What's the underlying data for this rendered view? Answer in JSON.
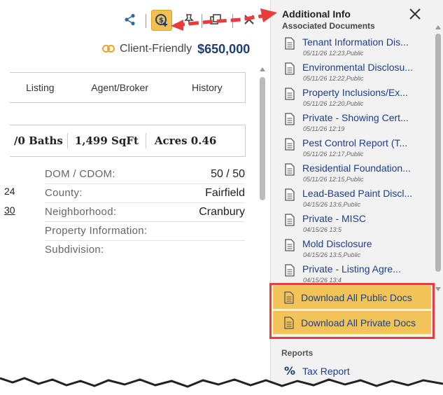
{
  "toolbar": {
    "icons": [
      "share-icon",
      "download-info-icon",
      "pin-icon",
      "copy-icon",
      "close-icon"
    ],
    "highlight_color": "#f3c04f"
  },
  "listing": {
    "client_friendly_label": "Client-Friendly",
    "price": "$650,000",
    "tabs": [
      "Listing",
      "Agent/Broker",
      "History"
    ],
    "stats": [
      "/0 Baths",
      "1,499 SqFt",
      "Acres 0.46"
    ],
    "details": [
      {
        "label": "DOM / CDOM:",
        "value": "50 / 50"
      },
      {
        "label": "County:",
        "value": "Fairfield"
      },
      {
        "label": "Neighborhood:",
        "value": "Cranbury"
      },
      {
        "label": "Property Information:",
        "value": ""
      },
      {
        "label": "Subdivision:",
        "value": ""
      }
    ],
    "fragments": [
      "24",
      "30"
    ]
  },
  "panel": {
    "title": "Additional Info",
    "section": "Associated Documents",
    "documents": [
      {
        "name": "Tenant Information Dis...",
        "meta": "05/11/26 12:23,Public"
      },
      {
        "name": "Environmental Disclosu...",
        "meta": "05/11/26 12:22,Public"
      },
      {
        "name": "Property Inclusions/Ex...",
        "meta": "05/11/26 12:20,Public"
      },
      {
        "name": "Private - Showing Cert...",
        "meta": "05/11/26 12:19"
      },
      {
        "name": "Pest Control Report (T...",
        "meta": "05/11/26 12:17,Public"
      },
      {
        "name": "Residential Foundation...",
        "meta": "05/11/26 12:15,Public"
      },
      {
        "name": "Lead-Based Paint Discl...",
        "meta": "04/15/26 13:6,Public"
      },
      {
        "name": "Private - MISC",
        "meta": "04/15/26 13:5"
      },
      {
        "name": "Mold Disclosure",
        "meta": "04/15/26 13:5,Public"
      },
      {
        "name": "Private - Listing Agre...",
        "meta": "04/15/26 13:4"
      }
    ],
    "download_public": "Download All Public Docs",
    "download_private": "Download All Private Docs",
    "reports_heading": "Reports",
    "tax_report": "Tax Report",
    "accent_color": "#ea3c3c"
  }
}
